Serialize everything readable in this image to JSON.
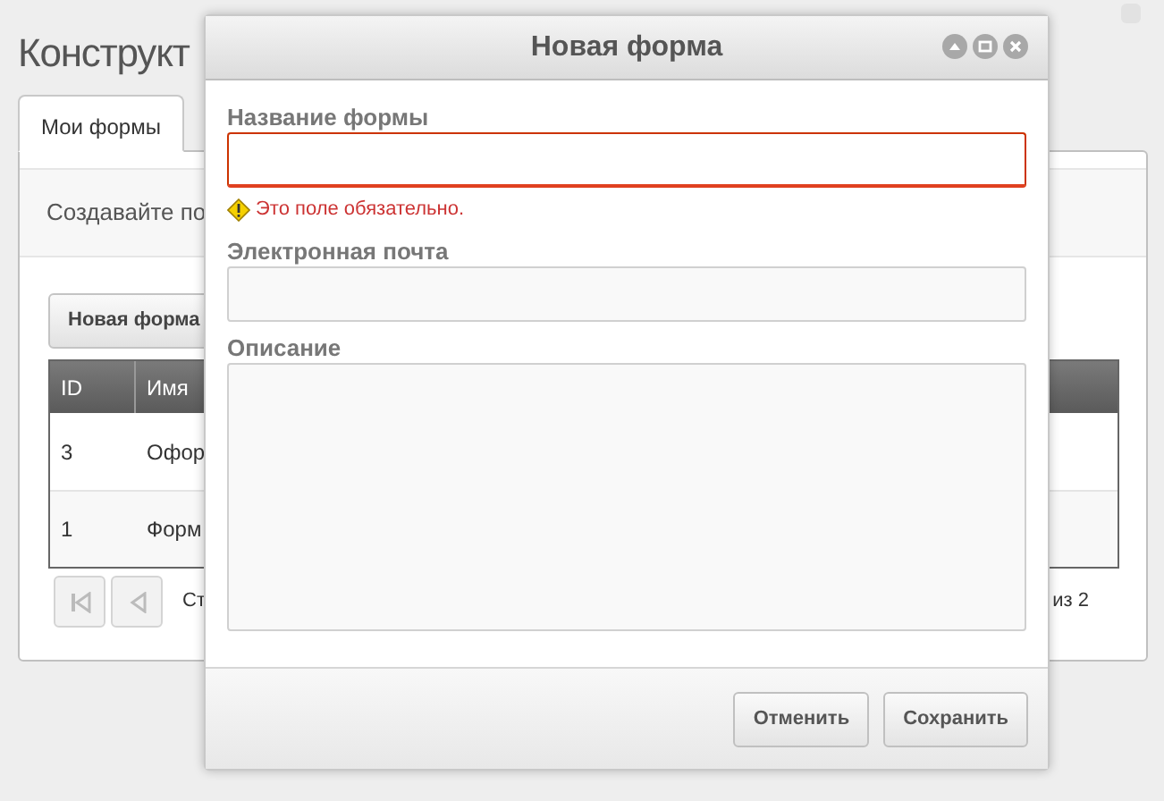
{
  "page": {
    "title": "Конструкт"
  },
  "tabs": [
    {
      "label": "Мои формы",
      "selected": true
    }
  ],
  "intro": "Создавайте по",
  "toolbar": {
    "button": "Новая форма"
  },
  "table": {
    "columns": [
      "ID",
      "Имя"
    ],
    "rows": [
      [
        "3",
        "Офор"
      ],
      [
        "1",
        "Форм"
      ]
    ]
  },
  "pager": {
    "buttons": [
      {
        "kind": "first",
        "disabled": true
      },
      {
        "kind": "prev",
        "disabled": true
      }
    ],
    "page_label": "Ст",
    "total": "из 2"
  },
  "dialog": {
    "title": "Новая форма",
    "fields": [
      {
        "label": "Название формы",
        "kind": "input",
        "invalid": true,
        "error": "Это поле обязательно."
      },
      {
        "label": "Электронная почта",
        "kind": "input",
        "invalid": false
      },
      {
        "label": "Описание",
        "kind": "textarea",
        "invalid": false
      }
    ],
    "buttons": [
      "Отменить",
      "Сохранить"
    ]
  }
}
